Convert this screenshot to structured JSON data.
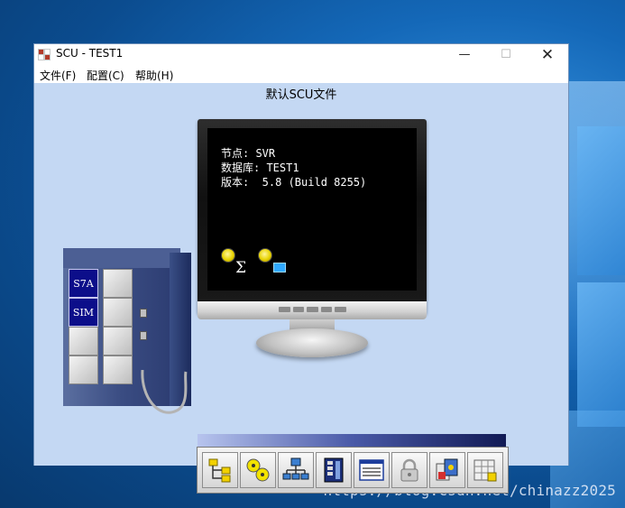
{
  "window": {
    "title": "SCU - TEST1",
    "minimize_glyph": "—",
    "maximize_glyph": "☐",
    "close_glyph": "✕"
  },
  "menubar": {
    "items": [
      {
        "label": "文件(F)"
      },
      {
        "label": "配置(C)"
      },
      {
        "label": "帮助(H)"
      }
    ]
  },
  "document": {
    "title": "默认SCU文件"
  },
  "monitor": {
    "lines": [
      "节点: SVR",
      "数据库: TEST1",
      "版本:  5.8 (Build 8255)"
    ],
    "icons": [
      "alarm-sum-icon",
      "alarm-network-icon"
    ],
    "sigma": "Σ"
  },
  "plc": {
    "modules": [
      "S7A",
      "SIM"
    ]
  },
  "toolbar": {
    "buttons": [
      {
        "icon": "path-configuration-icon"
      },
      {
        "icon": "startup-tasks-icon"
      },
      {
        "icon": "network-configuration-icon"
      },
      {
        "icon": "scada-configuration-icon"
      },
      {
        "icon": "alarm-configuration-icon"
      },
      {
        "icon": "security-lock-icon"
      },
      {
        "icon": "sql-configuration-icon"
      },
      {
        "icon": "database-tables-icon"
      }
    ]
  },
  "watermark": "https://blog.csdn.net/chinazz2025",
  "colors": {
    "content_bg": "#c4d8f3",
    "screen_bg": "#000000",
    "module_blue": "#0c0e8a"
  }
}
